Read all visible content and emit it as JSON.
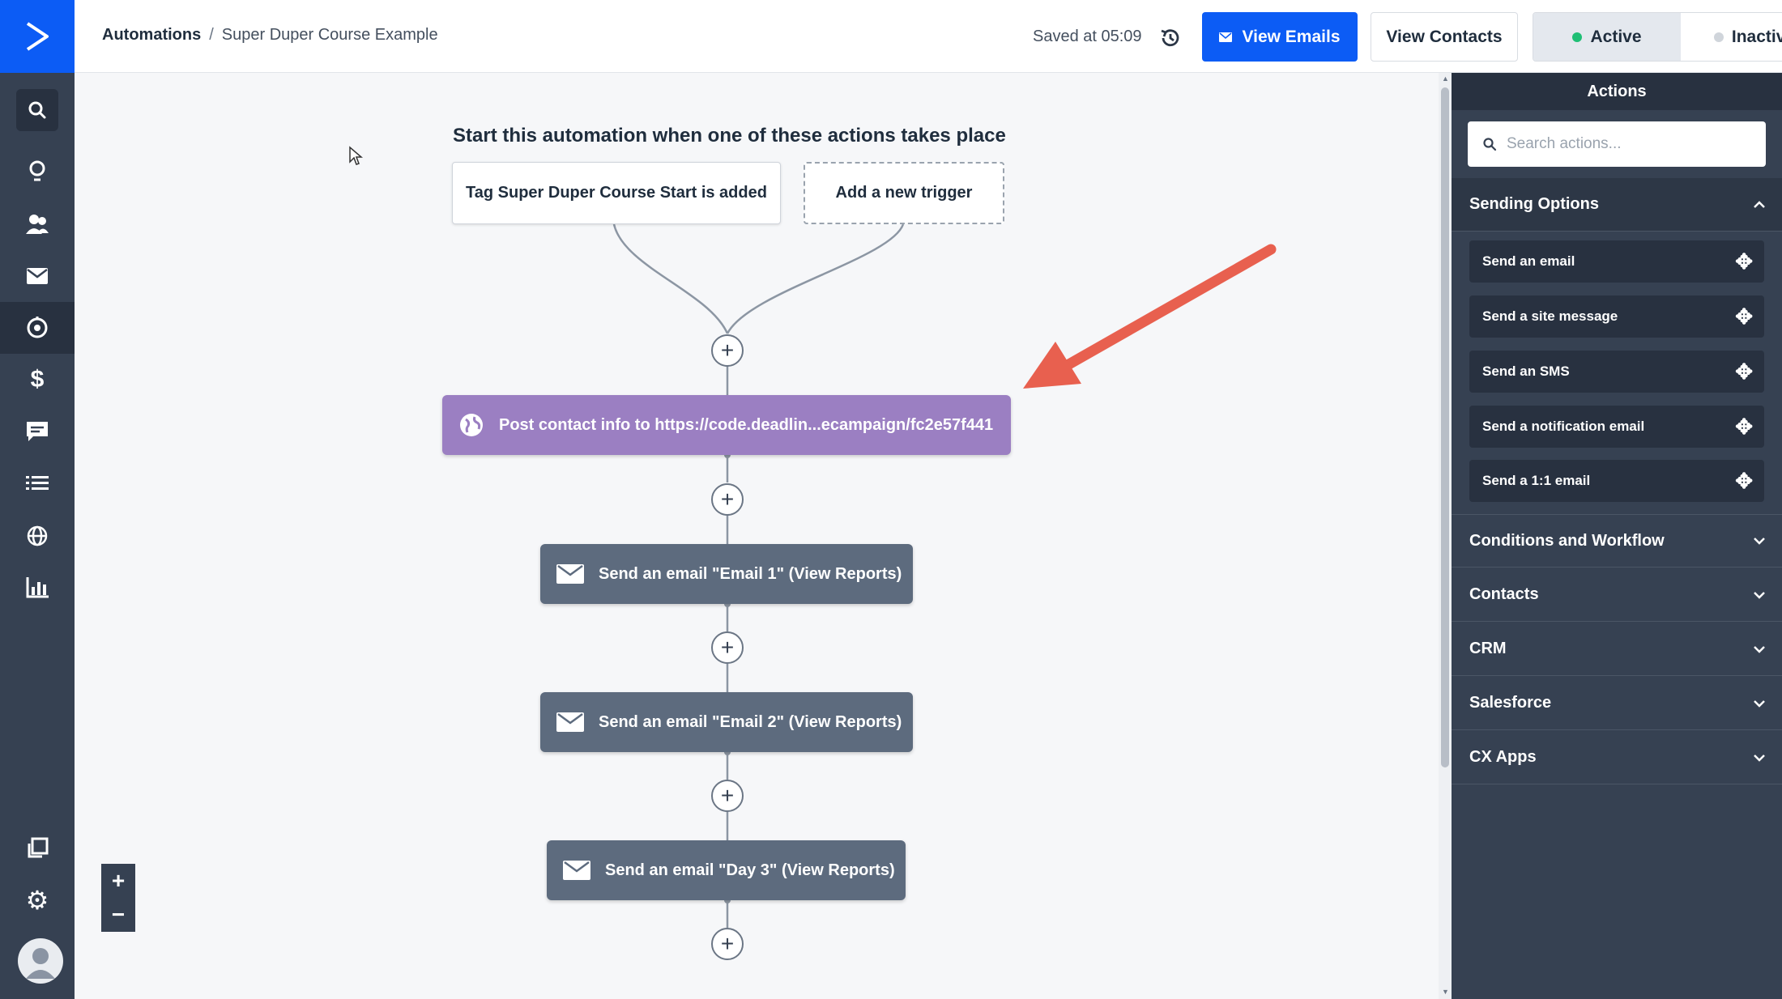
{
  "breadcrumb": {
    "root": "Automations",
    "separator": "/",
    "current": "Super Duper Course Example"
  },
  "header": {
    "saved_text": "Saved at 05:09",
    "view_emails": "View Emails",
    "view_contacts": "View Contacts",
    "active": "Active",
    "inactive": "Inactive"
  },
  "colors": {
    "brand": "#0c5cf5",
    "active_dot": "#1fbf75",
    "inactive_dot": "#d0d5db",
    "arrow": "#e8604f",
    "webhook": "#9b7fc2",
    "email_node": "#5d6b7e"
  },
  "sidebar": {
    "items": [
      {
        "icon": "search-icon"
      },
      {
        "icon": "lightbulb-icon"
      },
      {
        "icon": "contacts-icon"
      },
      {
        "icon": "envelope-icon"
      },
      {
        "icon": "automation-icon"
      },
      {
        "icon": "dollar-icon"
      },
      {
        "icon": "chat-icon"
      },
      {
        "icon": "list-icon"
      },
      {
        "icon": "globe-icon"
      },
      {
        "icon": "reports-icon"
      },
      {
        "icon": "pages-icon"
      },
      {
        "icon": "gear-icon"
      }
    ]
  },
  "canvas": {
    "start_title": "Start this automation when one of these actions takes place",
    "trigger_1": "Tag Super Duper Course Start is added",
    "trigger_2": "Add a new trigger",
    "webhook_node": "Post contact info to https://code.deadlin...ecampaign/fc2e57f441",
    "email_nodes": [
      "Send an email \"Email 1\" (View Reports)",
      "Send an email \"Email 2\" (View Reports)",
      "Send an email \"Day 3\" (View Reports)"
    ],
    "plus_symbol": "+",
    "zoom_in": "+",
    "zoom_out": "−"
  },
  "panel": {
    "title": "Actions",
    "search_placeholder": "Search actions...",
    "sending_options": {
      "label": "Sending Options",
      "items": [
        "Send an email",
        "Send a site message",
        "Send an SMS",
        "Send a notification email",
        "Send a 1:1 email"
      ]
    },
    "sections": [
      "Conditions and Workflow",
      "Contacts",
      "CRM",
      "Salesforce",
      "CX Apps"
    ]
  }
}
